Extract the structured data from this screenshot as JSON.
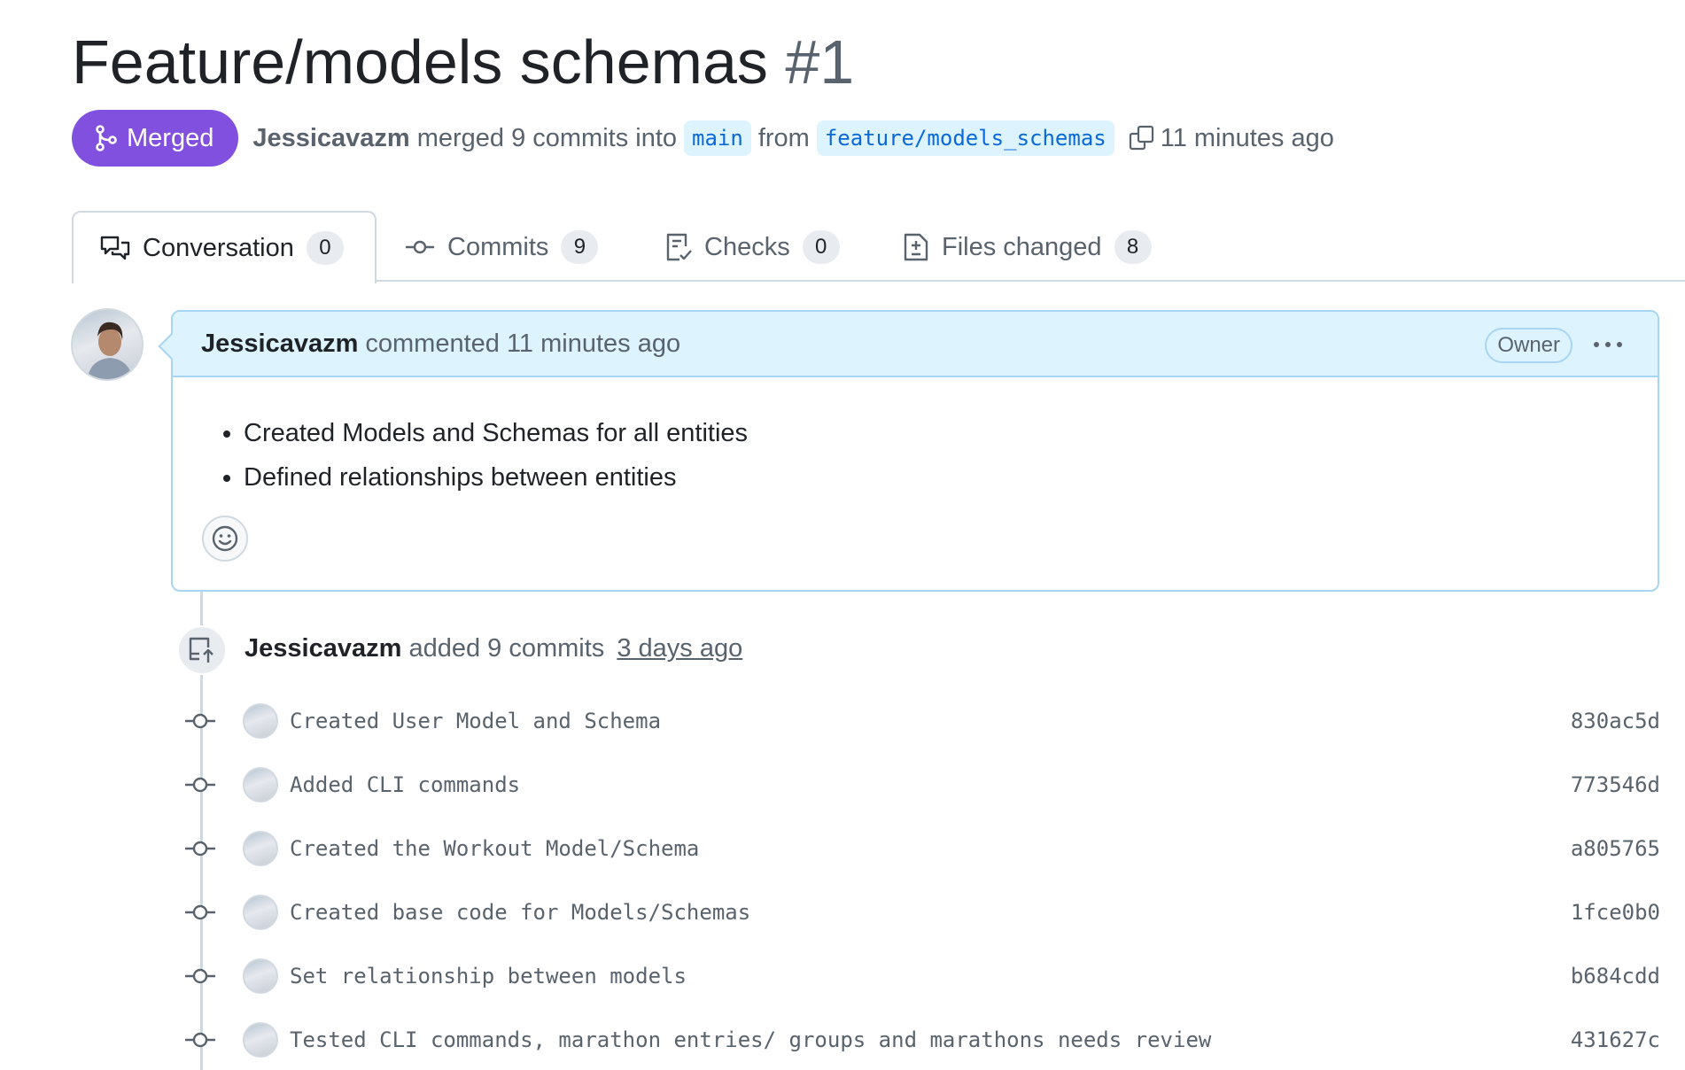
{
  "pr": {
    "title": "Feature/models schemas",
    "number": "#1",
    "state": "Merged",
    "author": "Jessicavazm",
    "merged_text": "merged 9 commits into",
    "base_branch": "main",
    "from_text": "from",
    "head_branch": "feature/models_schemas",
    "time_ago": "11 minutes ago"
  },
  "tabs": [
    {
      "label": "Conversation",
      "count": "0",
      "icon": "comment-discussion-icon"
    },
    {
      "label": "Commits",
      "count": "9",
      "icon": "git-commit-icon"
    },
    {
      "label": "Checks",
      "count": "0",
      "icon": "checklist-icon"
    },
    {
      "label": "Files changed",
      "count": "8",
      "icon": "file-diff-icon"
    }
  ],
  "comment": {
    "author": "Jessicavazm",
    "action": "commented 11 minutes ago",
    "role": "Owner",
    "body": [
      "Created Models and Schemas for all entities",
      "Defined relationships between entities"
    ]
  },
  "push_event": {
    "author": "Jessicavazm",
    "text": "added 9 commits",
    "time": "3 days ago"
  },
  "commits": [
    {
      "message": "Created User Model and Schema",
      "sha": "830ac5d"
    },
    {
      "message": "Added CLI commands",
      "sha": "773546d"
    },
    {
      "message": "Created the Workout Model/Schema",
      "sha": "a805765"
    },
    {
      "message": "Created base code for Models/Schemas",
      "sha": "1fce0b0"
    },
    {
      "message": "Set relationship between models",
      "sha": "b684cdd"
    },
    {
      "message": "Tested CLI commands, marathon entries/ groups and marathons needs review",
      "sha": "431627c"
    }
  ],
  "colors": {
    "merged": "#8250df",
    "branch_bg": "#ddf4ff",
    "branch_fg": "#0969da",
    "comment_header_bg": "#ddf4ff",
    "comment_border": "#a8d5f2"
  }
}
